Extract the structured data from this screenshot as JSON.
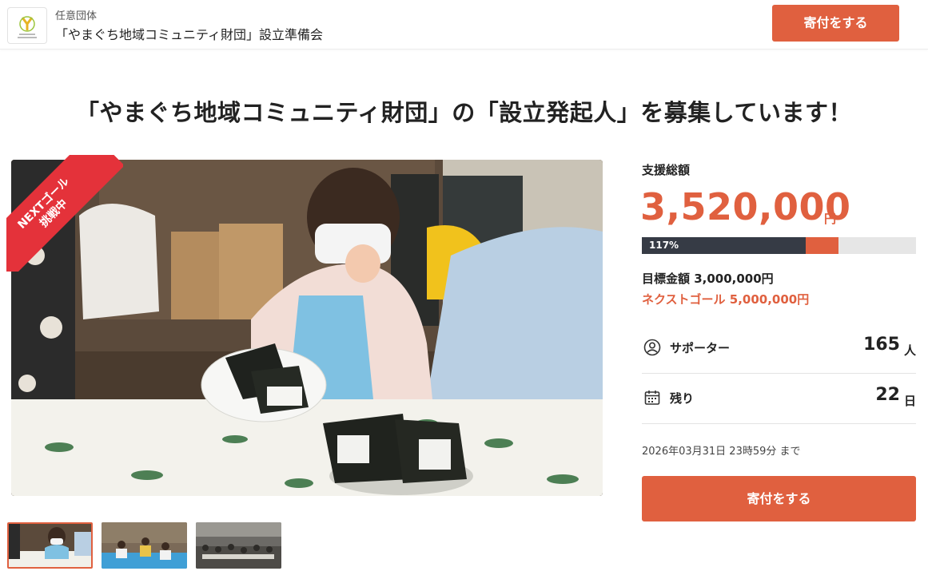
{
  "header": {
    "org_type": "任意団体",
    "org_name": "「やまぐち地域コミュニティ財団」設立準備会",
    "donate_label": "寄付をする"
  },
  "title": "「やまぐち地域コミュニティ財団」の「設立発起人」を募集しています！",
  "badge": {
    "line1": "NEXTゴール",
    "line2": "挑戦中"
  },
  "gallery": {
    "thumbnails": [
      "thumbnail-1",
      "thumbnail-2",
      "thumbnail-3"
    ],
    "active_index": 0
  },
  "stats": {
    "total_label": "支援総額",
    "total_amount": "3,520,000",
    "currency": "円",
    "progress_percent_label": "117%",
    "progress_percent": 117,
    "goal_text": "目標金額 3,000,000円",
    "next_goal_text": "ネクストゴール 5,000,000円",
    "supporters_label": "サポーター",
    "supporters_value": "165",
    "supporters_unit": "人",
    "remaining_label": "残り",
    "remaining_value": "22",
    "remaining_unit": "日",
    "deadline": "2026年03月31日 23時59分 まで",
    "donate_label": "寄付をする"
  },
  "colors": {
    "accent": "#e0603f",
    "progress_dark": "#363b45",
    "badge_red": "#e4323a"
  },
  "icons": {
    "supporters": "person-circle-icon",
    "remaining": "calendar-icon"
  }
}
